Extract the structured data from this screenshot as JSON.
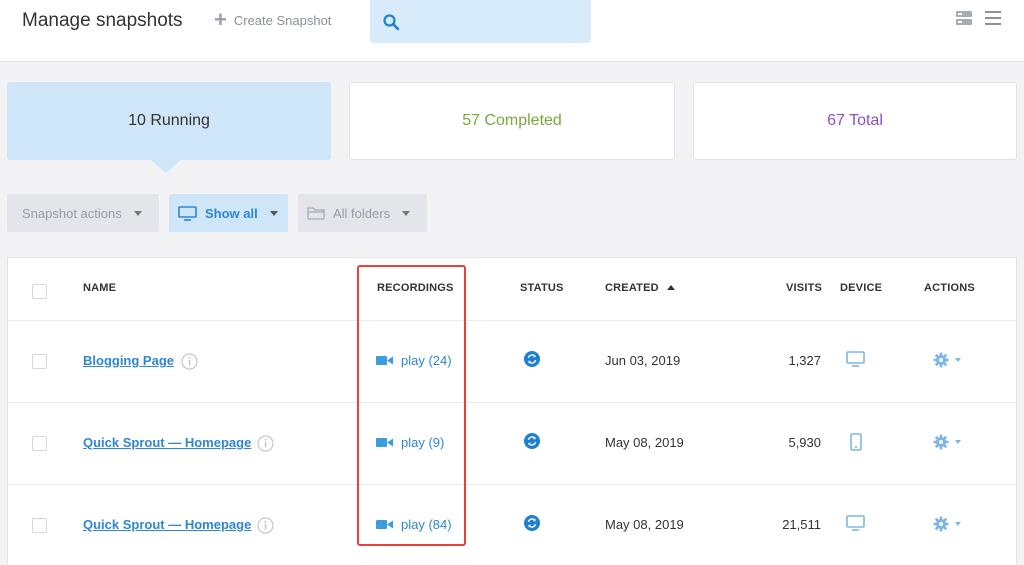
{
  "header": {
    "title": "Manage snapshots",
    "create_label": "Create Snapshot",
    "search_placeholder": ""
  },
  "stats": {
    "running": "10 Running",
    "completed": "57 Completed",
    "total": "67 Total"
  },
  "filters": {
    "snapshot_actions": "Snapshot actions",
    "show_all": "Show all",
    "all_folders": "All folders"
  },
  "table": {
    "columns": {
      "name": "NAME",
      "recordings": "RECORDINGS",
      "status": "STATUS",
      "created": "CREATED",
      "visits": "VISITS",
      "device": "DEVICE",
      "actions": "ACTIONS"
    },
    "rows": [
      {
        "name": "Blogging Page",
        "recordings": "play (24)",
        "status_icon": "sync-icon",
        "created": "Jun 03, 2019",
        "visits": "1,327",
        "device_icon": "desktop-icon"
      },
      {
        "name": "Quick Sprout — Homepage",
        "recordings": "play (9)",
        "status_icon": "sync-icon",
        "created": "May 08, 2019",
        "visits": "5,930",
        "device_icon": "mobile-icon"
      },
      {
        "name": "Quick Sprout — Homepage",
        "recordings": "play (84)",
        "status_icon": "sync-icon",
        "created": "May 08, 2019",
        "visits": "21,511",
        "device_icon": "desktop-icon"
      }
    ]
  },
  "colors": {
    "accent": "#2e86d4",
    "running_bg": "#cfe5f8",
    "completed": "#79a93c",
    "total": "#8a4fc7",
    "highlight": "#e8403a"
  }
}
